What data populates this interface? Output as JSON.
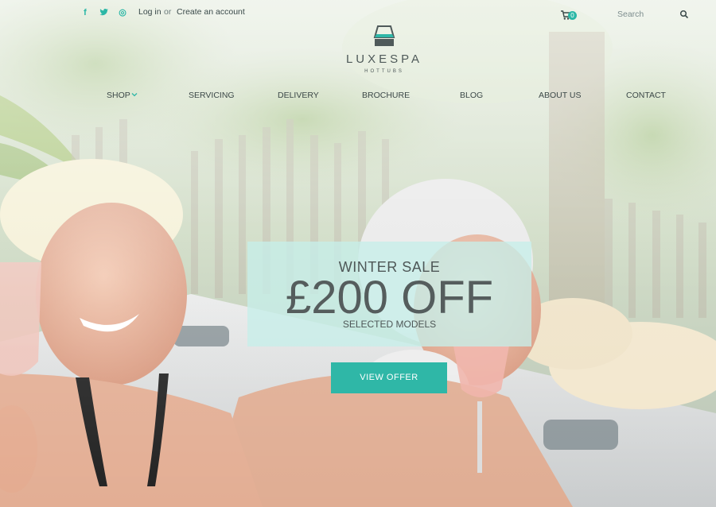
{
  "social": {
    "facebook": "f",
    "twitter": "t",
    "instagram": "◎"
  },
  "account": {
    "login": "Log in",
    "separator": "or",
    "create": "Create an account"
  },
  "cart": {
    "count": "0"
  },
  "search": {
    "placeholder": "Search"
  },
  "logo": {
    "name": "LUXESPA",
    "tagline": "HOTTUBS"
  },
  "nav": {
    "shop": "SHOP",
    "servicing": "SERVICING",
    "delivery": "DELIVERY",
    "brochure": "BROCHURE",
    "blog": "BLOG",
    "about": "ABOUT US",
    "contact": "CONTACT"
  },
  "promo": {
    "kicker": "WINTER SALE",
    "headline": "£200 OFF",
    "subline": "SELECTED MODELS",
    "cta": "VIEW OFFER"
  },
  "colors": {
    "accent": "#2fb7a7",
    "promo_panel": "#c7eee9",
    "text_dark": "#555d5d"
  }
}
